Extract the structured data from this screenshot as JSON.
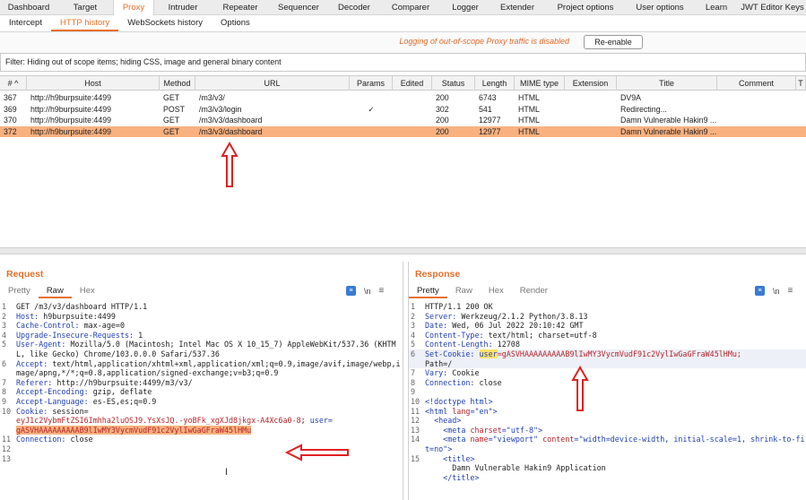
{
  "top_tabs": [
    {
      "label": "Dashboard",
      "width": 64
    },
    {
      "label": "Target",
      "width": 62
    },
    {
      "label": "Proxy",
      "width": 46,
      "active": true
    },
    {
      "label": "Intruder",
      "width": 64
    },
    {
      "label": "Repeater",
      "width": 64
    },
    {
      "label": "Sequencer",
      "width": 66
    },
    {
      "label": "Decoder",
      "width": 58
    },
    {
      "label": "Comparer",
      "width": 68
    },
    {
      "label": "Logger",
      "width": 54
    },
    {
      "label": "Extender",
      "width": 62
    },
    {
      "label": "Project options",
      "width": 90
    },
    {
      "label": "User options",
      "width": 76
    },
    {
      "label": "Learn",
      "width": 50
    },
    {
      "label": "JWT Editor Keys",
      "width": 75
    }
  ],
  "proxy_tabs": [
    {
      "label": "Intercept"
    },
    {
      "label": "HTTP history",
      "active": true
    },
    {
      "label": "WebSockets history"
    },
    {
      "label": "Options"
    }
  ],
  "logging_message": "Logging of out-of-scope Proxy traffic is disabled",
  "reenable_label": "Re-enable",
  "filter_text": "Filter: Hiding out of scope items;  hiding CSS, image and general binary content",
  "table": {
    "columns": [
      "# ^",
      "Host",
      "Method",
      "URL",
      "Params",
      "Edited",
      "Status",
      "Length",
      "MIME type",
      "Extension",
      "Title",
      "Comment",
      "T"
    ],
    "rows": [
      {
        "num": "367",
        "host": "http://h9burpsuite:4499",
        "method": "GET",
        "url": "/m3/v3/",
        "params": "",
        "edited": "",
        "status": "200",
        "length": "6743",
        "mime": "HTML",
        "extension": "",
        "title": "DV9A",
        "comment": "",
        "selected": false
      },
      {
        "num": "369",
        "host": "http://h9burpsuite:4499",
        "method": "POST",
        "url": "/m3/v3/login",
        "params": "✓",
        "edited": "",
        "status": "302",
        "length": "541",
        "mime": "HTML",
        "extension": "",
        "title": "Redirecting...",
        "comment": "",
        "selected": false
      },
      {
        "num": "370",
        "host": "http://h9burpsuite:4499",
        "method": "GET",
        "url": "/m3/v3/dashboard",
        "params": "",
        "edited": "",
        "status": "200",
        "length": "12977",
        "mime": "HTML",
        "extension": "",
        "title": "Damn Vulnerable Hakin9 ...",
        "comment": "",
        "selected": false
      },
      {
        "num": "372",
        "host": "http://h9burpsuite:4499",
        "method": "GET",
        "url": "/m3/v3/dashboard",
        "params": "",
        "edited": "",
        "status": "200",
        "length": "12977",
        "mime": "HTML",
        "extension": "",
        "title": "Damn Vulnerable Hakin9 ...",
        "comment": "",
        "selected": true
      }
    ]
  },
  "request": {
    "title": "Request",
    "tabs": [
      "Pretty",
      "Raw",
      "Hex"
    ],
    "active_tab": "Raw",
    "icon_msg": "≡",
    "icon_n": "\\n",
    "icon_menu": "≡",
    "lines": {
      "l1": "GET /m3/v3/dashboard HTTP/1.1",
      "l2n": "Host:",
      "l2v": " h9burpsuite:4499",
      "l3n": "Cache-Control:",
      "l3v": " max-age=0",
      "l4n": "Upgrade-Insecure-Requests:",
      "l4v": " 1",
      "l5n": "User-Agent:",
      "l5v": " Mozilla/5.0 (Macintosh; Intel Mac OS X 10_15_7) AppleWebKit/537.36 (KHTML, like Gecko) Chrome/103.0.0.0 Safari/537.36",
      "l6n": "Accept:",
      "l6v": " text/html,application/xhtml+xml,application/xml;q=0.9,image/avif,image/webp,image/apng,*/*;q=0.8,application/signed-exchange;v=b3;q=0.9",
      "l7n": "Referer:",
      "l7v": " http://h9burpsuite:4499/m3/v3/",
      "l8n": "Accept-Encoding:",
      "l8v": " gzip, deflate",
      "l9n": "Accept-Language:",
      "l9v": " es-ES,es;q=0.9",
      "l10n": "Cookie:",
      "l10v": " session=",
      "l10c": "eyJ1c2VybmFtZSI6Imhha2luOSJ9.YsXsJQ.-yoBFk_xgXJd8jkgx-A4Xc6a0-8",
      "l10sep": "; ",
      "l10u": "user=",
      "l10hl": "gASVHAAAAAAAAAB9lIwMY3VycmVudF91c2VylIwGaGFraW45lHMu",
      "l11n": "Connection:",
      "l11v": " close",
      "l12": "",
      "l13": ""
    }
  },
  "response": {
    "title": "Response",
    "tabs": [
      "Pretty",
      "Raw",
      "Hex",
      "Render"
    ],
    "active_tab": "Pretty",
    "icon_msg": "≡",
    "icon_n": "\\n",
    "icon_menu": "≡",
    "lines": {
      "l1": "HTTP/1.1 200 OK",
      "l2n": "Server:",
      "l2v": " Werkzeug/2.1.2 Python/3.8.13",
      "l3n": "Date:",
      "l3v": " Wed, 06 Jul 2022 20:10:42 GMT",
      "l4n": "Content-Type:",
      "l4v": " text/html; charset=utf-8",
      "l5n": "Content-Length:",
      "l5v": " 12708",
      "l6n": "Set-Cookie:",
      "l6u": "user",
      "l6v": "=gASVHAAAAAAAAAB9lIwMY3VycmVudF91c2VylIwGaGFraW45lHMu;",
      "l6path": "Path=/",
      "l7n": "Vary:",
      "l7v": " Cookie",
      "l8n": "Connection:",
      "l8v": " close",
      "l9": "",
      "l10": "<!doctype html>",
      "l11a": "<html ",
      "l11b": "lang",
      "l11c": "=\"en\"",
      "l11d": ">",
      "l12": "<head>",
      "l13a": "<meta ",
      "l13b": "charset",
      "l13c": "=\"utf-8\"",
      "l13d": ">",
      "l14a": "<meta ",
      "l14b": "name",
      "l14c": "=\"viewport\" ",
      "l14e": "content",
      "l14f": "=\"width=device-width, initial-scale=1, shrink-to-fit=no\"",
      "l14d": ">",
      "l15a": "<title>",
      "l15b": "Damn Vulnerable Hakin9 Application",
      "l15c": "</title>"
    }
  },
  "colors": {
    "accent": "#e8702a",
    "selected_row": "#f9b17f",
    "annotation_arrow": "#e02020"
  }
}
